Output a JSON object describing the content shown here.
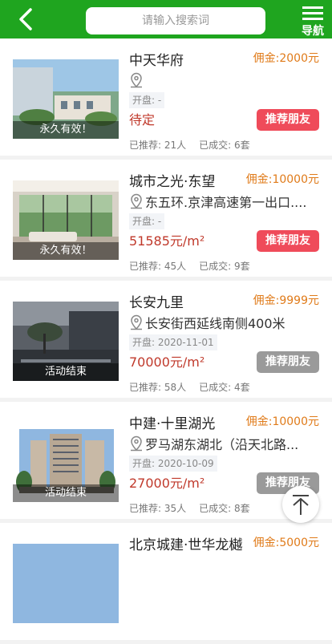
{
  "header": {
    "search_placeholder": "请输入搜索词",
    "nav_label": "导航",
    "brand_color": "#1fa51f"
  },
  "listings": [
    {
      "title": "中天华府",
      "commission": "佣金:2000元",
      "address": "",
      "open": "开盘: -",
      "price": "待定",
      "tag": "永久有效！",
      "button": "推荐朋友",
      "button_active": true,
      "recommended": "已推荐: 21人",
      "deals": "已成交: 6套"
    },
    {
      "title": "城市之光·东望",
      "commission": "佣金:10000元",
      "address": "东五环.京津高速第一出口....",
      "open": "开盘: -",
      "price": "51585元/m²",
      "tag": "永久有效！",
      "button": "推荐朋友",
      "button_active": true,
      "recommended": "已推荐: 45人",
      "deals": "已成交: 9套"
    },
    {
      "title": "长安九里",
      "commission": "佣金:9999元",
      "address": "长安街西延线南侧400米",
      "open": "开盘: 2020-11-01",
      "price": "70000元/m²",
      "tag": "活动结束",
      "button": "推荐朋友",
      "button_active": false,
      "recommended": "已推荐: 58人",
      "deals": "已成交: 4套"
    },
    {
      "title": "中建·十里湖光",
      "commission": "佣金:10000元",
      "address": "罗马湖东湖北（沿天北路...",
      "open": "开盘: 2020-10-09",
      "price": "27000元/m²",
      "tag": "活动结束",
      "button": "推荐朋友",
      "button_active": false,
      "recommended": "已推荐: 35人",
      "deals": "已成交: 8套"
    },
    {
      "title": "北京城建·世华龙樾",
      "commission": "佣金:5000元"
    }
  ]
}
